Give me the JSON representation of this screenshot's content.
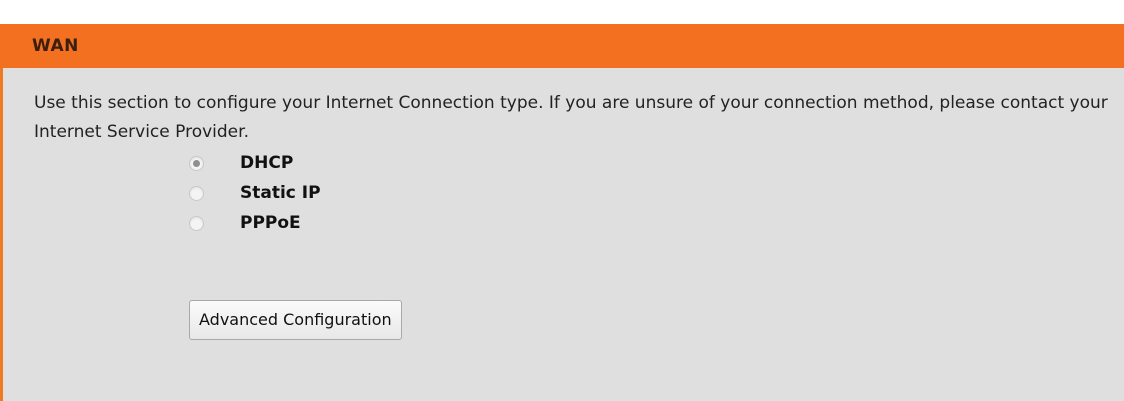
{
  "section": {
    "title": "WAN",
    "description": "Use this section to configure your Internet Connection type. If you are unsure of your connection method, please contact your Internet Service Provider."
  },
  "connection_types": [
    {
      "label": "DHCP",
      "selected": true
    },
    {
      "label": "Static IP",
      "selected": false
    },
    {
      "label": "PPPoE",
      "selected": false
    }
  ],
  "buttons": {
    "advanced_configuration": "Advanced Configuration"
  },
  "colors": {
    "header_orange": "#f37021",
    "panel_background": "#dfdfdf"
  }
}
